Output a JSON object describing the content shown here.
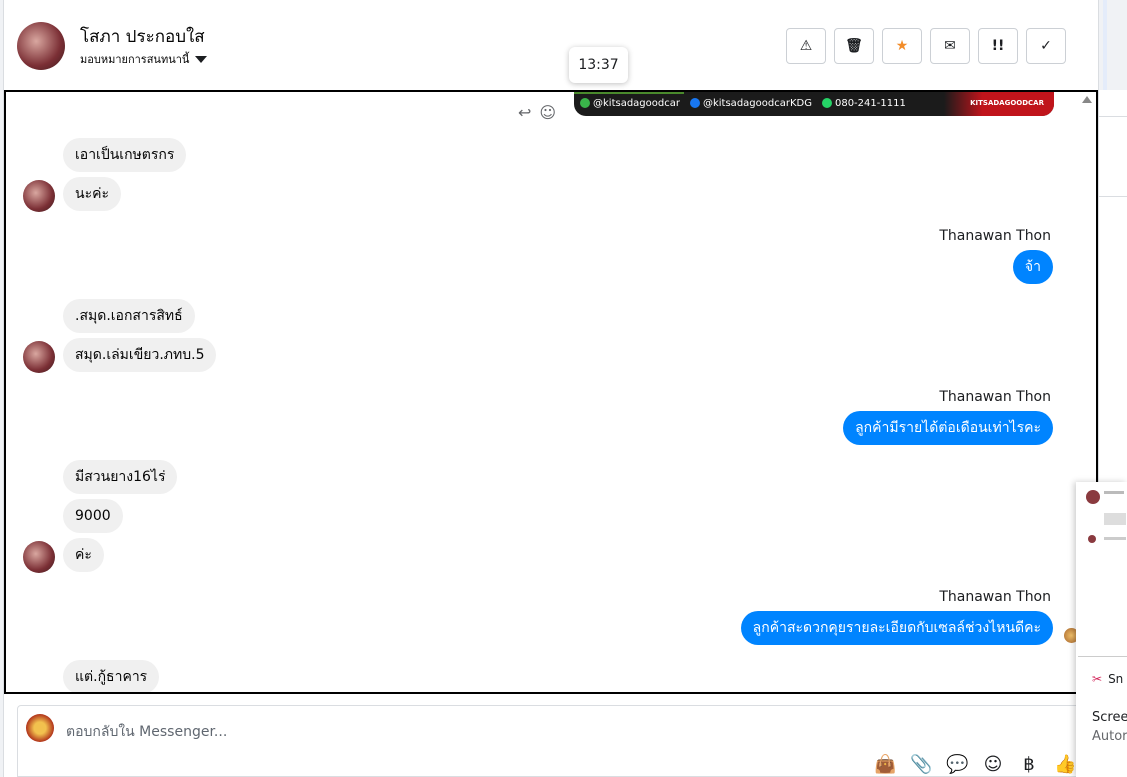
{
  "header": {
    "contact_name": "โสภา ประกอบใส",
    "assign_label": "มอบหมายการสนทนานี้",
    "actions": [
      {
        "name": "report-button",
        "icon": "⚠"
      },
      {
        "name": "delete-button",
        "icon": "🗑"
      },
      {
        "name": "star-button",
        "icon": "★"
      },
      {
        "name": "mark-unread-button",
        "icon": "✉"
      },
      {
        "name": "follow-up-button",
        "icon": "!!"
      },
      {
        "name": "mark-done-button",
        "icon": "✓"
      }
    ]
  },
  "tooltip": {
    "time": "13:37"
  },
  "banner": {
    "line_id": "@kitsadagoodcar",
    "facebook": "@kitsadagoodcarKDG",
    "phone": "080-241-1111",
    "brand": "KITSADAGOODCAR"
  },
  "messages": {
    "in1": "เอาเป็นเกษตรกร",
    "in2": "นะค่ะ",
    "out_sender": "Thanawan Thon",
    "out1": "จ้า",
    "in3": ".สมุด.เอกสารสิทธ์",
    "in4": "สมุด.เล่มเขียว.ภทบ.5",
    "out2": "ลูกค้ามีรายได้ต่อเดือนเท่าไรคะ",
    "in5": "มีสวนยาง16ไร่",
    "in6": "9000",
    "in7": "ค่ะ",
    "out3": "ลูกค้าสะดวกคุยรายละเอียดกับเซลล์ช่วงไหนดีคะ",
    "in8": "แต่.กู้ธาคาร"
  },
  "composer": {
    "placeholder": "ตอบกลับใน Messenger...",
    "currency_symbol": "฿"
  },
  "popup": {
    "snip_label": "Sn",
    "title": "Scree",
    "subtitle": "Autor"
  }
}
